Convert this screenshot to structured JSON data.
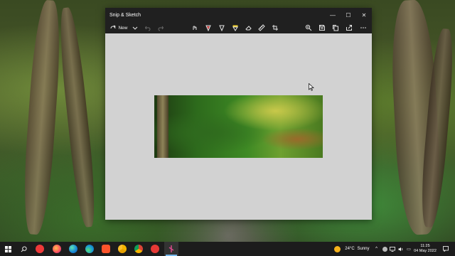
{
  "window": {
    "title": "Snip & Sketch",
    "controls": {
      "minimize": "—",
      "maximize": "☐",
      "close": "✕"
    }
  },
  "toolbar": {
    "new_label": "New",
    "icons": [
      "new-snip-icon",
      "undo-icon",
      "redo-icon",
      "touch-writing-icon",
      "ballpoint-pen-icon",
      "pencil-icon",
      "highlighter-icon",
      "eraser-icon",
      "ruler-icon",
      "crop-icon",
      "zoom-icon",
      "save-icon",
      "copy-icon",
      "share-icon",
      "more-icon"
    ],
    "colors": {
      "pen": "#e04a4a",
      "highlighter": "#f2d12c"
    }
  },
  "taskbar": {
    "weather": {
      "temp": "24°C",
      "condition": "Sunny"
    },
    "clock": {
      "time": "11:25",
      "date": "04 May 2022"
    }
  }
}
